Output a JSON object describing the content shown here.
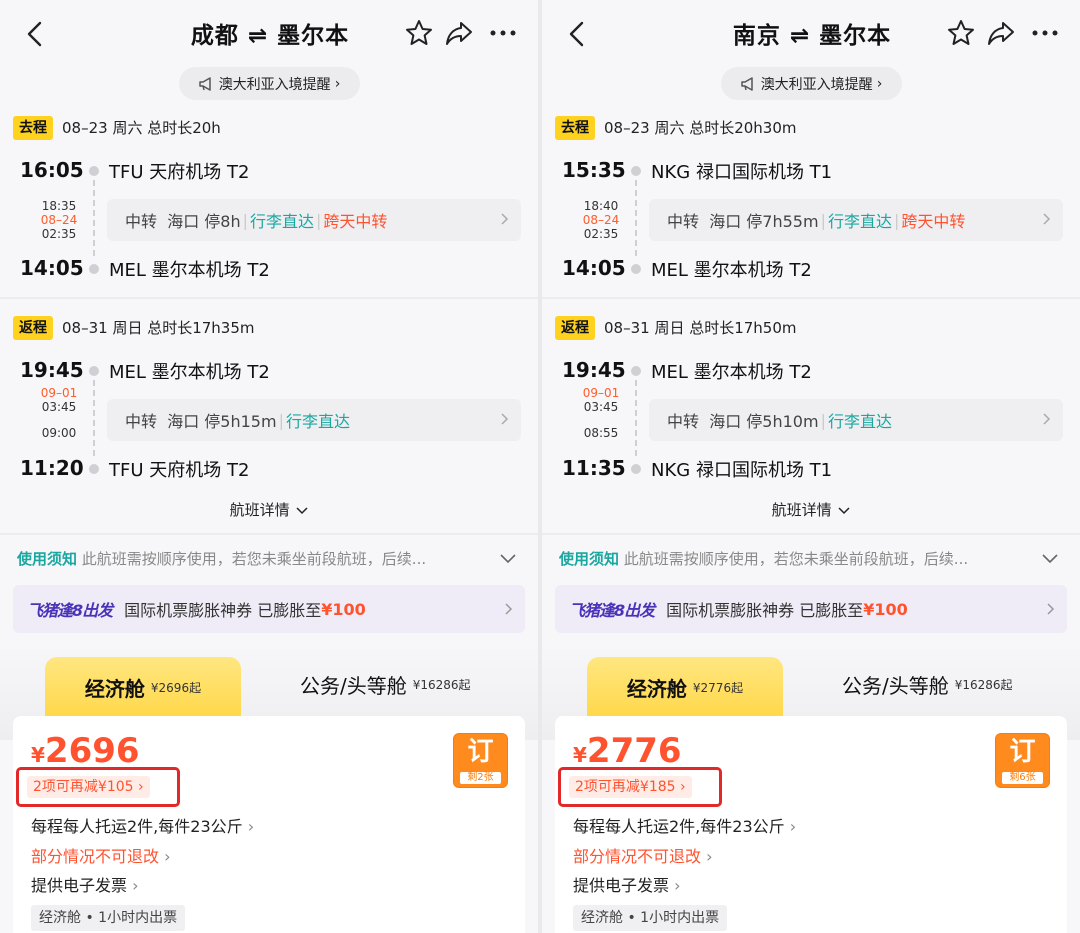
{
  "panels": [
    {
      "title": "成都 ⇌ 墨尔本",
      "notice": "澳大利亚入境提醒",
      "outbound": {
        "tag": "去程",
        "info": "08–23  周六  总时长20h",
        "dep_time": "16:05",
        "dep_airport": "TFU 天府机场 T2",
        "stop_arr": "18:35",
        "stop_date": "08–24",
        "stop_dep": "02:35",
        "transfer_label": "中转",
        "transfer_city": "海口",
        "stay": "停8h",
        "baggage": "行李直达",
        "overnight": "跨天中转",
        "arr_time": "14:05",
        "arr_airport": "MEL 墨尔本机场 T2"
      },
      "return": {
        "tag": "返程",
        "info": "08–31  周日  总时长17h35m",
        "dep_time": "19:45",
        "dep_airport": "MEL 墨尔本机场 T2",
        "stop_date": "09–01",
        "stop_arr": "03:45",
        "stop_dep": "09:00",
        "transfer_label": "中转",
        "transfer_city": "海口",
        "stay": "停5h15m",
        "baggage": "行李直达",
        "arr_time": "11:20",
        "arr_airport": "TFU 天府机场 T2"
      },
      "details_link": "航班详情",
      "rules_label": "使用须知",
      "rules_text": "此航班需按顺序使用，若您未乘坐前段航班，后续...",
      "promo_logo": "飞猪逢8出发",
      "promo_text": "国际机票膨胀神券 已膨胀至",
      "promo_amount": "¥100",
      "eco_name": "经济舱",
      "eco_from": "¥2696起",
      "biz_name": "公务/头等舱",
      "biz_from": "¥16286起",
      "price_symbol": "¥",
      "price": "2696",
      "book_label": "订",
      "remaining": "剩2张",
      "discount": "2项可再减¥105",
      "baggage_rule": "每程每人托运2件,每件23公斤",
      "refund_rule": "部分情况不可退改",
      "invoice": "提供电子发票",
      "cabin_tag": "经济舱 • 1小时内出票"
    },
    {
      "title": "南京 ⇌ 墨尔本",
      "notice": "澳大利亚入境提醒",
      "outbound": {
        "tag": "去程",
        "info": "08–23  周六  总时长20h30m",
        "dep_time": "15:35",
        "dep_airport": "NKG 禄口国际机场 T1",
        "stop_arr": "18:40",
        "stop_date": "08–24",
        "stop_dep": "02:35",
        "transfer_label": "中转",
        "transfer_city": "海口",
        "stay": "停7h55m",
        "baggage": "行李直达",
        "overnight": "跨天中转",
        "arr_time": "14:05",
        "arr_airport": "MEL 墨尔本机场 T2"
      },
      "return": {
        "tag": "返程",
        "info": "08–31  周日  总时长17h50m",
        "dep_time": "19:45",
        "dep_airport": "MEL 墨尔本机场 T2",
        "stop_date": "09–01",
        "stop_arr": "03:45",
        "stop_dep": "08:55",
        "transfer_label": "中转",
        "transfer_city": "海口",
        "stay": "停5h10m",
        "baggage": "行李直达",
        "arr_time": "11:35",
        "arr_airport": "NKG 禄口国际机场 T1"
      },
      "details_link": "航班详情",
      "rules_label": "使用须知",
      "rules_text": "此航班需按顺序使用，若您未乘坐前段航班，后续...",
      "promo_logo": "飞猪逢8出发",
      "promo_text": "国际机票膨胀神券 已膨胀至",
      "promo_amount": "¥100",
      "eco_name": "经济舱",
      "eco_from": "¥2776起",
      "biz_name": "公务/头等舱",
      "biz_from": "¥16286起",
      "price_symbol": "¥",
      "price": "2776",
      "book_label": "订",
      "remaining": "剩6张",
      "discount": "2项可再减¥185",
      "baggage_rule": "每程每人托运2件,每件23公斤",
      "refund_rule": "部分情况不可退改",
      "invoice": "提供电子发票",
      "cabin_tag": "经济舱 • 1小时内出票"
    }
  ]
}
